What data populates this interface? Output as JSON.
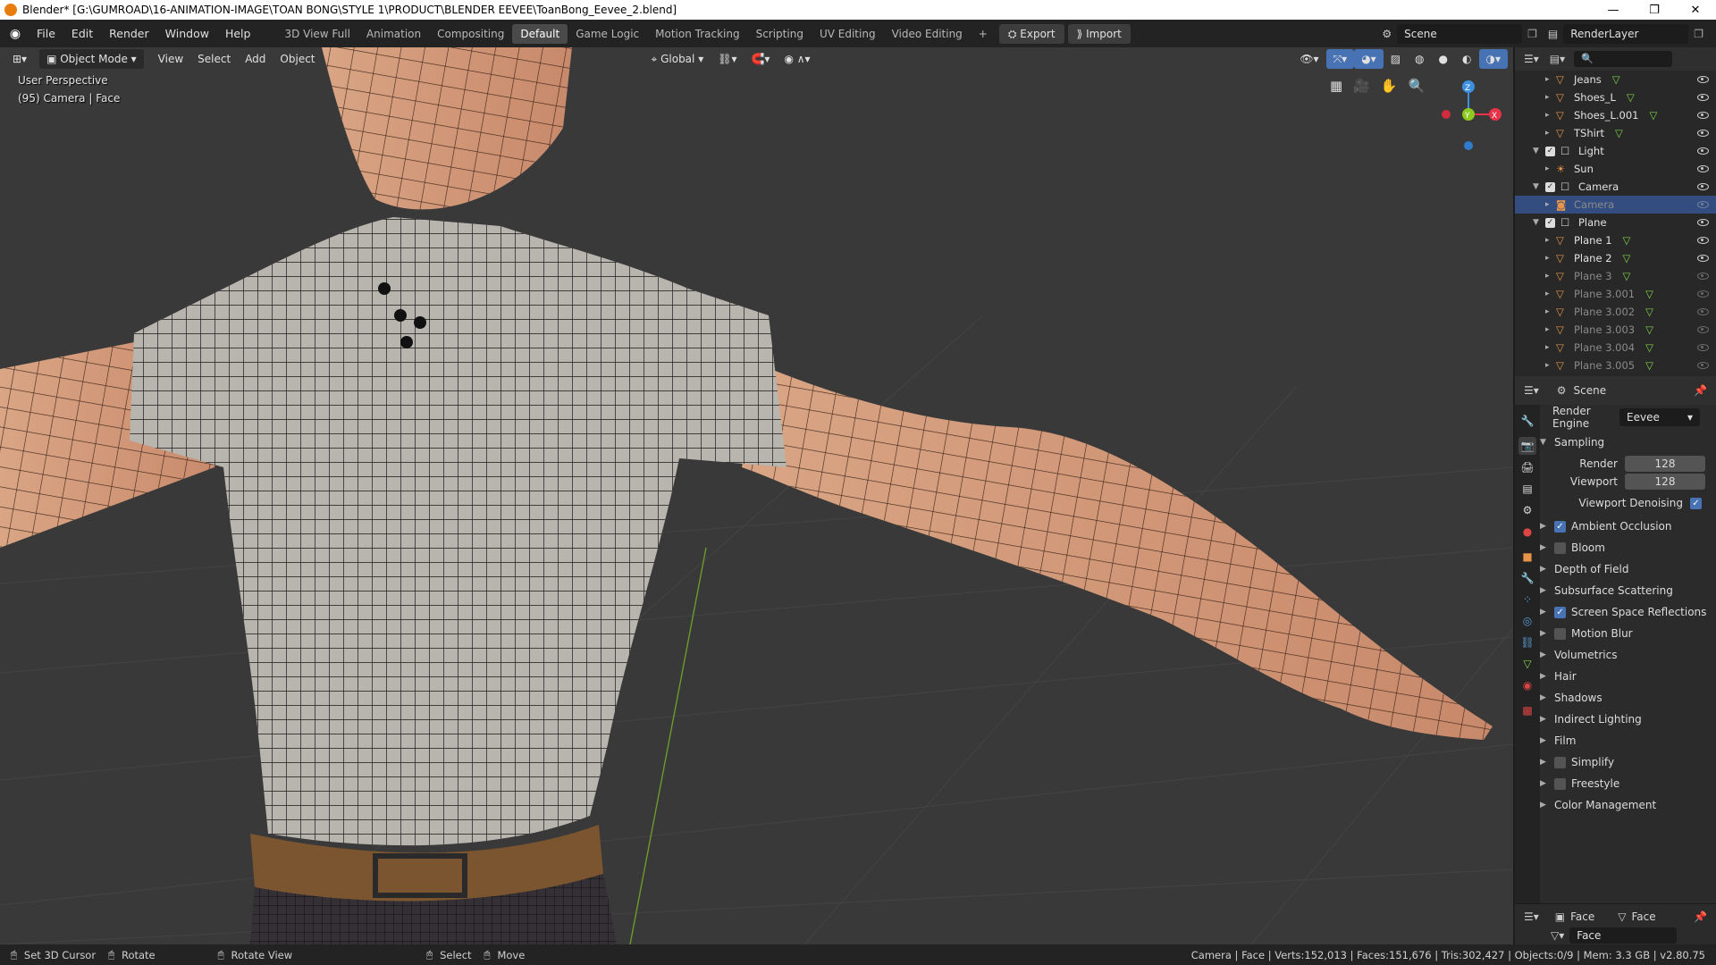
{
  "titlebar": {
    "title": "Blender* [G:\\GUMROAD\\16-ANIMATION-IMAGE\\TOAN BONG\\STYLE 1\\PRODUCT\\BLENDER EEVEE\\ToanBong_Eevee_2.blend]",
    "minimize": "—",
    "maximize": "❐",
    "close": "✕"
  },
  "menu": [
    "File",
    "Edit",
    "Render",
    "Window",
    "Help"
  ],
  "workspaces": [
    {
      "label": "3D View Full",
      "active": false
    },
    {
      "label": "Animation",
      "active": false
    },
    {
      "label": "Compositing",
      "active": false
    },
    {
      "label": "Default",
      "active": true
    },
    {
      "label": "Game Logic",
      "active": false
    },
    {
      "label": "Motion Tracking",
      "active": false
    },
    {
      "label": "Scripting",
      "active": false
    },
    {
      "label": "UV Editing",
      "active": false
    },
    {
      "label": "Video Editing",
      "active": false
    }
  ],
  "add_workspace": "+",
  "export_label": "Export",
  "import_label": "Import",
  "scene_name": "Scene",
  "view_layer": "RenderLayer",
  "viewport": {
    "mode": "Object Mode",
    "menus": [
      "View",
      "Select",
      "Add",
      "Object"
    ],
    "transform_orientation": "Global",
    "perspective": "User Perspective",
    "context": "(95) Camera | Face",
    "gizmo": {
      "x": "X",
      "y": "Y",
      "z": "Z"
    }
  },
  "outliner": {
    "rows": [
      {
        "label": "Jeans",
        "indent": 2,
        "kind": "mesh",
        "visible": true,
        "dim": false,
        "selected": false
      },
      {
        "label": "Shoes_L",
        "indent": 2,
        "kind": "mesh",
        "visible": true,
        "dim": false,
        "selected": false
      },
      {
        "label": "Shoes_L.001",
        "indent": 2,
        "kind": "mesh",
        "visible": true,
        "dim": false,
        "selected": false
      },
      {
        "label": "TShirt",
        "indent": 2,
        "kind": "mesh",
        "visible": true,
        "dim": false,
        "selected": false
      },
      {
        "label": "Light",
        "indent": 1,
        "kind": "collection",
        "visible": true,
        "dim": false,
        "selected": false
      },
      {
        "label": "Sun",
        "indent": 2,
        "kind": "light",
        "visible": true,
        "dim": false,
        "selected": false
      },
      {
        "label": "Camera",
        "indent": 1,
        "kind": "collection",
        "visible": true,
        "dim": false,
        "selected": false
      },
      {
        "label": "Camera",
        "indent": 2,
        "kind": "camera",
        "visible": false,
        "dim": true,
        "selected": true
      },
      {
        "label": "Plane",
        "indent": 1,
        "kind": "collection",
        "visible": true,
        "dim": false,
        "selected": false
      },
      {
        "label": "Plane 1",
        "indent": 2,
        "kind": "mesh",
        "visible": true,
        "dim": false,
        "selected": false
      },
      {
        "label": "Plane 2",
        "indent": 2,
        "kind": "mesh",
        "visible": true,
        "dim": false,
        "selected": false
      },
      {
        "label": "Plane 3",
        "indent": 2,
        "kind": "mesh",
        "visible": false,
        "dim": true,
        "selected": false
      },
      {
        "label": "Plane 3.001",
        "indent": 2,
        "kind": "mesh",
        "visible": false,
        "dim": true,
        "selected": false
      },
      {
        "label": "Plane 3.002",
        "indent": 2,
        "kind": "mesh",
        "visible": false,
        "dim": true,
        "selected": false
      },
      {
        "label": "Plane 3.003",
        "indent": 2,
        "kind": "mesh",
        "visible": false,
        "dim": true,
        "selected": false
      },
      {
        "label": "Plane 3.004",
        "indent": 2,
        "kind": "mesh",
        "visible": false,
        "dim": true,
        "selected": false
      },
      {
        "label": "Plane 3.005",
        "indent": 2,
        "kind": "mesh",
        "visible": false,
        "dim": true,
        "selected": false
      }
    ]
  },
  "properties": {
    "context": "Scene",
    "render_engine_label": "Render Engine",
    "render_engine": "Eevee",
    "sampling_label": "Sampling",
    "render_label": "Render",
    "render_value": "128",
    "viewport_label": "Viewport",
    "viewport_value": "128",
    "denoise_label": "Viewport Denoising",
    "panels": [
      {
        "label": "Ambient Occlusion",
        "checkbox": true,
        "checked": true
      },
      {
        "label": "Bloom",
        "checkbox": true,
        "checked": false
      },
      {
        "label": "Depth of Field",
        "checkbox": false,
        "checked": false
      },
      {
        "label": "Subsurface Scattering",
        "checkbox": false,
        "checked": false
      },
      {
        "label": "Screen Space Reflections",
        "checkbox": true,
        "checked": true
      },
      {
        "label": "Motion Blur",
        "checkbox": true,
        "checked": false
      },
      {
        "label": "Volumetrics",
        "checkbox": false,
        "checked": false
      },
      {
        "label": "Hair",
        "checkbox": false,
        "checked": false
      },
      {
        "label": "Shadows",
        "checkbox": false,
        "checked": false
      },
      {
        "label": "Indirect Lighting",
        "checkbox": false,
        "checked": false
      },
      {
        "label": "Film",
        "checkbox": false,
        "checked": false
      },
      {
        "label": "Simplify",
        "checkbox": true,
        "checked": false
      },
      {
        "label": "Freestyle",
        "checkbox": true,
        "checked": false
      },
      {
        "label": "Color Management",
        "checkbox": false,
        "checked": false
      }
    ],
    "bottom_face_a": "Face",
    "bottom_face_b": "Face",
    "bottom_field": "Face"
  },
  "status": {
    "set_cursor": "Set 3D Cursor",
    "rotate": "Rotate",
    "rotate_view": "Rotate View",
    "select": "Select",
    "move": "Move",
    "stats": "Camera | Face | Verts:152,013 | Faces:151,676 | Tris:302,427 | Objects:0/9 | Mem: 3.3 GB | v2.80.75"
  },
  "colors": {
    "accent": "#4772b3",
    "selected_row": "#334d80",
    "orange_icon": "#e8954a",
    "green_icon": "#7ed348",
    "x_axis": "#e8334a",
    "y_axis": "#8bc91f",
    "z_axis": "#3d8fe0"
  }
}
